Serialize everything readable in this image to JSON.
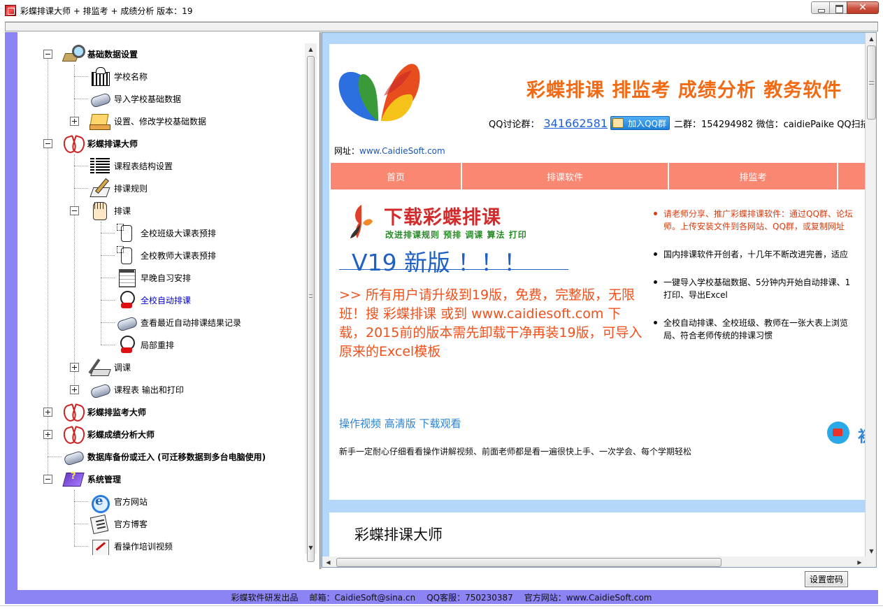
{
  "window": {
    "title": "彩蝶排课大师 + 排监考 + 成绩分析  版本：19",
    "close_glyph": "✕"
  },
  "tree": {
    "nodes": [
      {
        "label": "基础数据设置",
        "icon": "magnifier-icon"
      },
      {
        "label": "学校名称",
        "icon": "building-icon"
      },
      {
        "label": "导入学校基础数据",
        "icon": "scroll-icon"
      },
      {
        "label": "设置、修改学校基础数据",
        "icon": "laptop-icon"
      },
      {
        "label": "彩蝶排课大师",
        "icon": "butterfly-icon"
      },
      {
        "label": "课程表结构设置",
        "icon": "grid-icon"
      },
      {
        "label": "排课规则",
        "icon": "pen-icon"
      },
      {
        "label": "排课",
        "icon": "hand-icon"
      },
      {
        "label": "全校班级大课表预排",
        "icon": "tap-icon"
      },
      {
        "label": "全校教师大课表预排",
        "icon": "tap-icon"
      },
      {
        "label": "早晚自习安排",
        "icon": "calendar-icon"
      },
      {
        "label": "全校自动排课",
        "icon": "clock-icon"
      },
      {
        "label": "查看最近自动排课结果记录",
        "icon": "scroll-icon"
      },
      {
        "label": "局部重排",
        "icon": "clock-icon"
      },
      {
        "label": "调课",
        "icon": "tools-icon"
      },
      {
        "label": "课程表 输出和打印",
        "icon": "scroll-icon"
      },
      {
        "label": "彩蝶排监考大师",
        "icon": "butterfly-icon"
      },
      {
        "label": "彩蝶成绩分析大师",
        "icon": "butterfly-icon"
      },
      {
        "label": "数据库备份或迁入 (可迁移数据到多台电脑使用)",
        "icon": "scroll-icon"
      },
      {
        "label": "系统管理",
        "icon": "book-icon"
      },
      {
        "label": "官方网站",
        "icon": "ie-icon"
      },
      {
        "label": "官方博客",
        "icon": "blog-icon"
      },
      {
        "label": "看操作培训视频",
        "icon": "video-icon"
      }
    ]
  },
  "web": {
    "headline": "彩蝶排课 排监考 成绩分析 教务软件",
    "qq_label": "QQ讨论群：",
    "qq_number": "341662581",
    "qq_join_button": "加入QQ群",
    "qq_rest": "二群：154294982    微信：caidiePaike   QQ扫描",
    "site_label": "网址：",
    "site_url": "www.CaidieSoft.com",
    "nav": [
      "首页",
      "排课软件",
      "排监考",
      ""
    ],
    "download_title": "下载彩蝶排课",
    "download_sub": "改进排课规则 预排 调课 算法 打印",
    "v19": "V19 新版 ！！！",
    "upgrade_notice": ">> 所有用户请升级到19版，免费，完整版，无限班！搜 彩蝶排课 或到 www.caidiesoft.com 下载，2015前的版本需先卸载干净再装19版，可导入原来的Excel模板",
    "bullets": [
      {
        "l1": "请老师分享、推广彩蝶排课软件：通过QQ群、论坛",
        "l2": "师。上传安装文件到各网站、QQ群，或复制网址"
      },
      {
        "l1": "国内排课软件开创者，十几年不断改进完善，适应",
        "l2": ""
      },
      {
        "l1": "一键导入学校基础数据、5分钟内开始自动排课、1",
        "l2": "打印、导出Excel"
      },
      {
        "l1": "全校自动排课、全校班级、教师在一张大表上浏览",
        "l2": "局、符合老师传统的排课习惯"
      }
    ],
    "video_link": "操作视频 高清版 下载观看",
    "video_cut": "初",
    "newbie_tip": "新手一定耐心仔细看看操作讲解视频、前面老师都是看一遍很快上手、一次学会、每个学期轻松",
    "section2_title": "彩蝶排课大师"
  },
  "buttons": {
    "set_password": "设置密码"
  },
  "footer": {
    "producer": "彩蝶软件研发出品",
    "email": "邮箱：CaidieSoft@sina.cn",
    "qq_service": "QQ客服：750230387",
    "website": "官方网站：www.CaidieSoft.com"
  },
  "colors": {
    "frame": "#8c83f5",
    "headline": "#f26a14",
    "nav_bg": "#f98772",
    "link": "#1f60c5",
    "notice": "#f2501a"
  }
}
